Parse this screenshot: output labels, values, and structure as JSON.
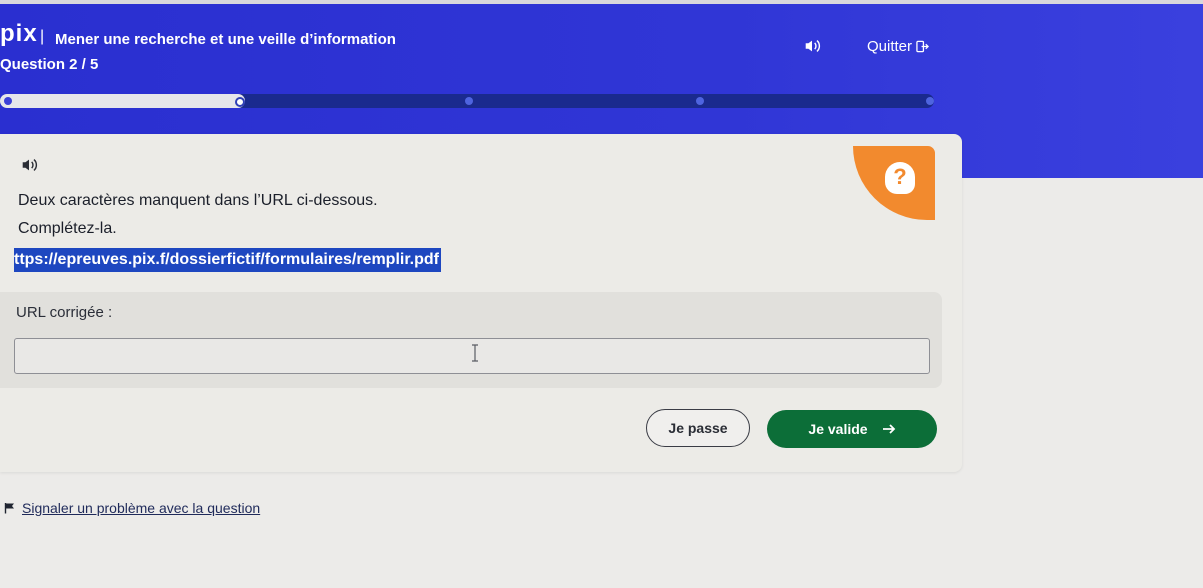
{
  "header": {
    "logo": "pix",
    "separator": "|",
    "title": "Mener une recherche et une veille d’information",
    "question_count": "Question 2 / 5",
    "quit_label": "Quitter",
    "progress": {
      "current": 2,
      "total": 5
    }
  },
  "question": {
    "line1": "Deux caractères manquent dans l’URL ci-dessous.",
    "line2": "Complétez-la.",
    "url": "ttps://epreuves.pix.f/dossierfictif/formulaires/remplir.pdf"
  },
  "answer": {
    "label": "URL corrigée :",
    "value": ""
  },
  "actions": {
    "skip_label": "Je passe",
    "validate_label": "Je valide"
  },
  "footer": {
    "report_label": "Signaler un problème avec la question"
  },
  "colors": {
    "header_blue": "#3036d6",
    "validate_green": "#0c6e38",
    "help_orange": "#f28a2e"
  }
}
